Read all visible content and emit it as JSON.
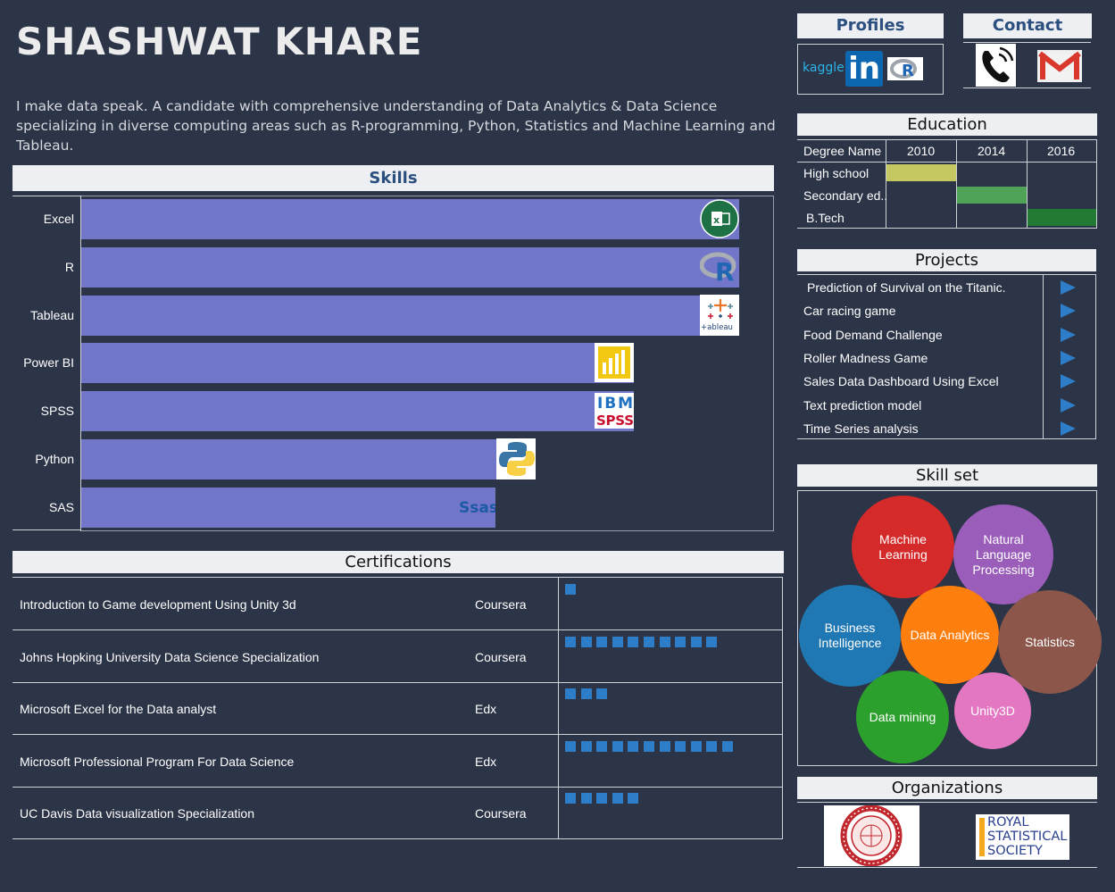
{
  "name": "SHASHWAT KHARE",
  "tagline": "I make data speak. A candidate with comprehensive understanding of Data Analytics & Data Science specializing in diverse computing areas such as R-programming, Python, Statistics and Machine Learning and Tableau.",
  "sections": {
    "skills": "Skills",
    "certifications": "Certifications",
    "profiles": "Profiles",
    "contact": "Contact",
    "education": "Education",
    "projects": "Projects",
    "skill_set": "Skill set",
    "organizations": "Organizations"
  },
  "chart_data": {
    "type": "bar",
    "orientation": "horizontal",
    "title": "Skills",
    "categories": [
      "Excel",
      "R",
      "Tableau",
      "Power BI",
      "SPSS",
      "Python",
      "SAS"
    ],
    "values": [
      100,
      100,
      100,
      84,
      84,
      69,
      63
    ],
    "logos": [
      "excel-icon",
      "r-icon",
      "tableau-icon",
      "powerbi-icon",
      "spss-icon",
      "python-icon",
      "sas-icon"
    ],
    "bar_color": "#7276c9",
    "xlim": [
      0,
      100
    ]
  },
  "profiles": {
    "kaggle": "kaggle",
    "linkedin": "in",
    "r": "R"
  },
  "education": {
    "header": "Degree Name",
    "years": [
      "2010",
      "2014",
      "2016"
    ],
    "rows": [
      {
        "label": "High school",
        "col": 0,
        "color": "#c5c860"
      },
      {
        "label": "Secondary ed..",
        "col": 1,
        "color": "#4ea356"
      },
      {
        "label": "B.Tech",
        "col": 2,
        "color": "#227a35"
      }
    ]
  },
  "projects": [
    "Prediction of Survival on the Titanic.",
    "Car racing game",
    "Food Demand Challenge",
    "Roller Madness Game",
    "Sales Data Dashboard Using Excel",
    "Text prediction model",
    "Time Series analysis"
  ],
  "certifications": [
    {
      "title": "Introduction to Game development Using Unity 3d",
      "provider": "Coursera",
      "squares": 1
    },
    {
      "title": "Johns Hopking University Data Science Specialization",
      "provider": "Coursera",
      "squares": 10
    },
    {
      "title": "Microsoft Excel for the Data analyst",
      "provider": "Edx",
      "squares": 3
    },
    {
      "title": "Microsoft Professional Program For Data Science",
      "provider": "Edx",
      "squares": 11
    },
    {
      "title": "UC Davis Data visualization Specialization",
      "provider": "Coursera",
      "squares": 5
    }
  ],
  "skill_set": [
    {
      "label": "Machine Learning",
      "color": "#d52a2a"
    },
    {
      "label": "Natural Language Processing",
      "color": "#9a5db9"
    },
    {
      "label": "Business Intelligence",
      "color": "#1f77b4"
    },
    {
      "label": "Data Analytics",
      "color": "#ff7f0e"
    },
    {
      "label": "Statistics",
      "color": "#8c564b"
    },
    {
      "label": "Data mining",
      "color": "#2ca02c"
    },
    {
      "label": "Unity3D",
      "color": "#e377c2"
    }
  ],
  "organizations": {
    "rss": [
      "ROYAL",
      "STATISTICAL",
      "SOCIETY"
    ]
  }
}
